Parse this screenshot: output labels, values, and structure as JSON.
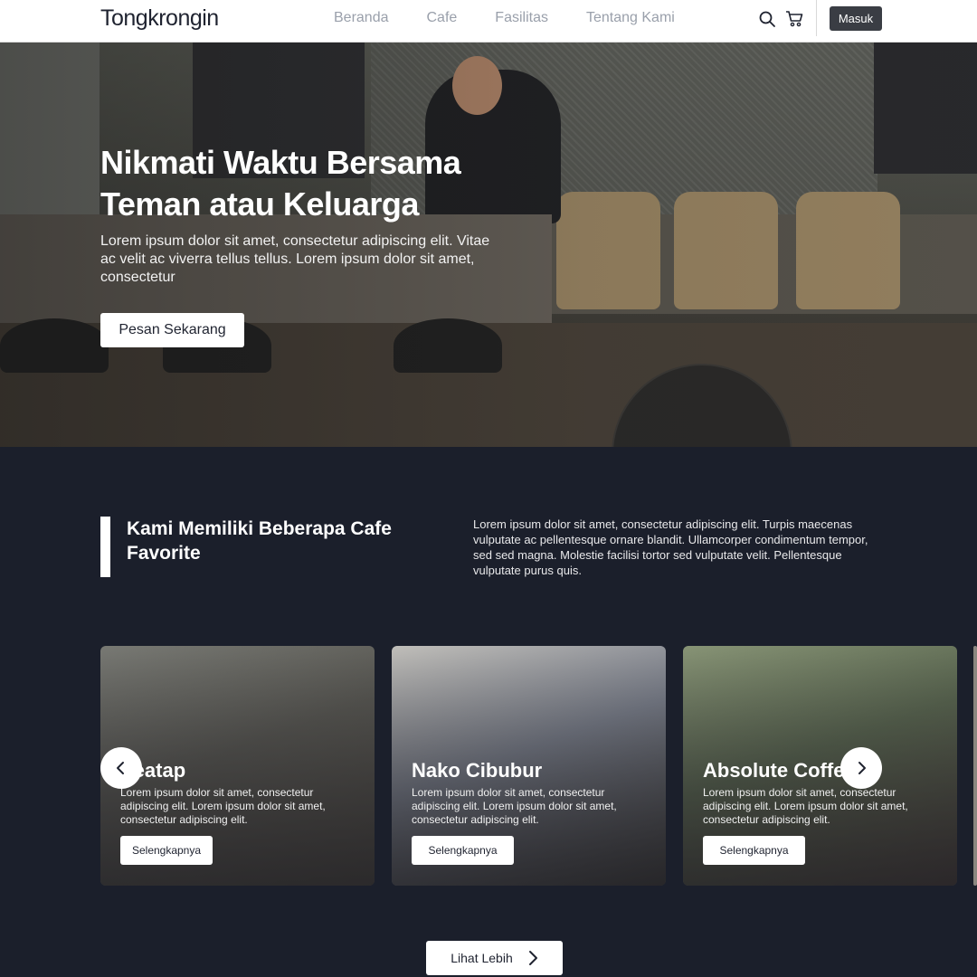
{
  "nav": {
    "brand": "Tongkrongin",
    "links": [
      "Beranda",
      "Cafe",
      "Fasilitas",
      "Tentang Kami"
    ],
    "login_label": "Masuk",
    "icons": [
      "search-icon",
      "cart-icon"
    ]
  },
  "hero": {
    "title": "Nikmati Waktu Bersama Teman atau Keluarga",
    "text": "Lorem ipsum dolor sit amet, consectetur adipiscing elit. Vitae ac velit ac viverra tellus tellus. Lorem ipsum dolor sit amet, consectetur",
    "cta_label": "Pesan Sekarang"
  },
  "section": {
    "title": "Kami Memiliki Beberapa Cafe Favorite",
    "description": "Lorem ipsum dolor sit amet, consectetur adipiscing elit. Turpis maecenas vulputate ac pellentesque ornare blandit. Ullamcorper condimentum tempor, sed sed magna. Molestie facilisi tortor sed vulputate velit. Pellentesque vulputate purus quis."
  },
  "cards": [
    {
      "title": "Seatap",
      "text": "Lorem ipsum dolor sit amet, consectetur adipiscing elit. Lorem ipsum dolor sit amet, consectetur adipiscing elit.",
      "button": "Selengkapnya"
    },
    {
      "title": "Nako Cibubur",
      "text": "Lorem ipsum dolor sit amet, consectetur adipiscing elit. Lorem ipsum dolor sit amet, consectetur adipiscing elit.",
      "button": "Selengkapnya"
    },
    {
      "title": "Absolute Coffee",
      "text": "Lorem ipsum dolor sit amet, consectetur adipiscing elit. Lorem ipsum dolor sit amet, consectetur adipiscing elit.",
      "button": "Selengkapnya"
    }
  ],
  "more_label": "Lihat Lebih",
  "colors": {
    "dark_bg": "#1b1f2b",
    "button_dark": "#3a3d44",
    "nav_link": "#9aa0ab"
  }
}
